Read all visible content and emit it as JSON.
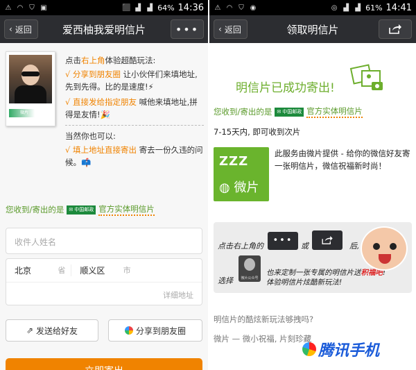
{
  "left": {
    "status": {
      "battery": "64%",
      "time": "14:36"
    },
    "nav": {
      "back_label": "返回",
      "title": "爱西柚我爱明信片",
      "more_label": "•••"
    },
    "tips": {
      "intro_a": "点击",
      "intro_link": "右上角",
      "intro_b": "体验超酷玩法:",
      "item1_hl": "√ 分享到朋友圈",
      "item1_rest": " 让小伙伴们来填地址,先到先得。比的是速度!⚡",
      "item2_hl": "√ 直接发给指定朋友",
      "item2_rest": " 喊他来填地址,拼得是友情!🎉",
      "also": "当然你也可以:",
      "item3_hl": "√ 填上地址直接寄出",
      "item3_rest": " 寄去一份久违的问候。📫"
    },
    "post": {
      "prefix": "您收到/寄出的是",
      "logo_text": "中国邮政",
      "suffix": "官方实体明信片"
    },
    "form": {
      "name_placeholder": "收件人姓名",
      "city": "北京",
      "province_suffix": "省",
      "district": "顺义区",
      "city_suffix": "市",
      "detail_placeholder": "详细地址"
    },
    "buttons": {
      "send_friend": "发送给好友",
      "share_moments": "分享到朋友圈",
      "submit": "立即寄出"
    },
    "photo": {
      "stamp_text": "微片"
    }
  },
  "right": {
    "status": {
      "battery": "61%",
      "time": "14:41"
    },
    "nav": {
      "back_label": "返回",
      "title": "领取明信片"
    },
    "sent_title": "明信片已成功寄出!",
    "post": {
      "prefix": "您收到/寄出的是",
      "logo_text": "中国邮政",
      "suffix": "官方实体明信片"
    },
    "days": "7-15天内, 即可收到次片",
    "logo_text": "微片",
    "service": "此服务由微片提供 - 给你的微信好友寄一张明信片，微信祝福新时尚！",
    "promo": {
      "t1": "点击右上角的",
      "t2": "或",
      "t3": "后,",
      "more_label": "•••",
      "t4": "选择",
      "acct_label": "微片公众号",
      "t5a": "也来定制一张专属的明信片送",
      "t5_red": "积福吧",
      "t5b": "!",
      "t5c": "体验明信片炫酷新玩法!"
    },
    "faq": "明信片的酷炫新玩法够拽吗?",
    "sig": "微片 — 微小祝福, 片刻珍藏"
  },
  "watermark": "腾讯手机",
  "colors": {
    "accent_green": "#6dae2d",
    "accent_orange": "#f08300",
    "navbar": "#2c2d31",
    "watermark_blue": "#1a5bd9"
  }
}
